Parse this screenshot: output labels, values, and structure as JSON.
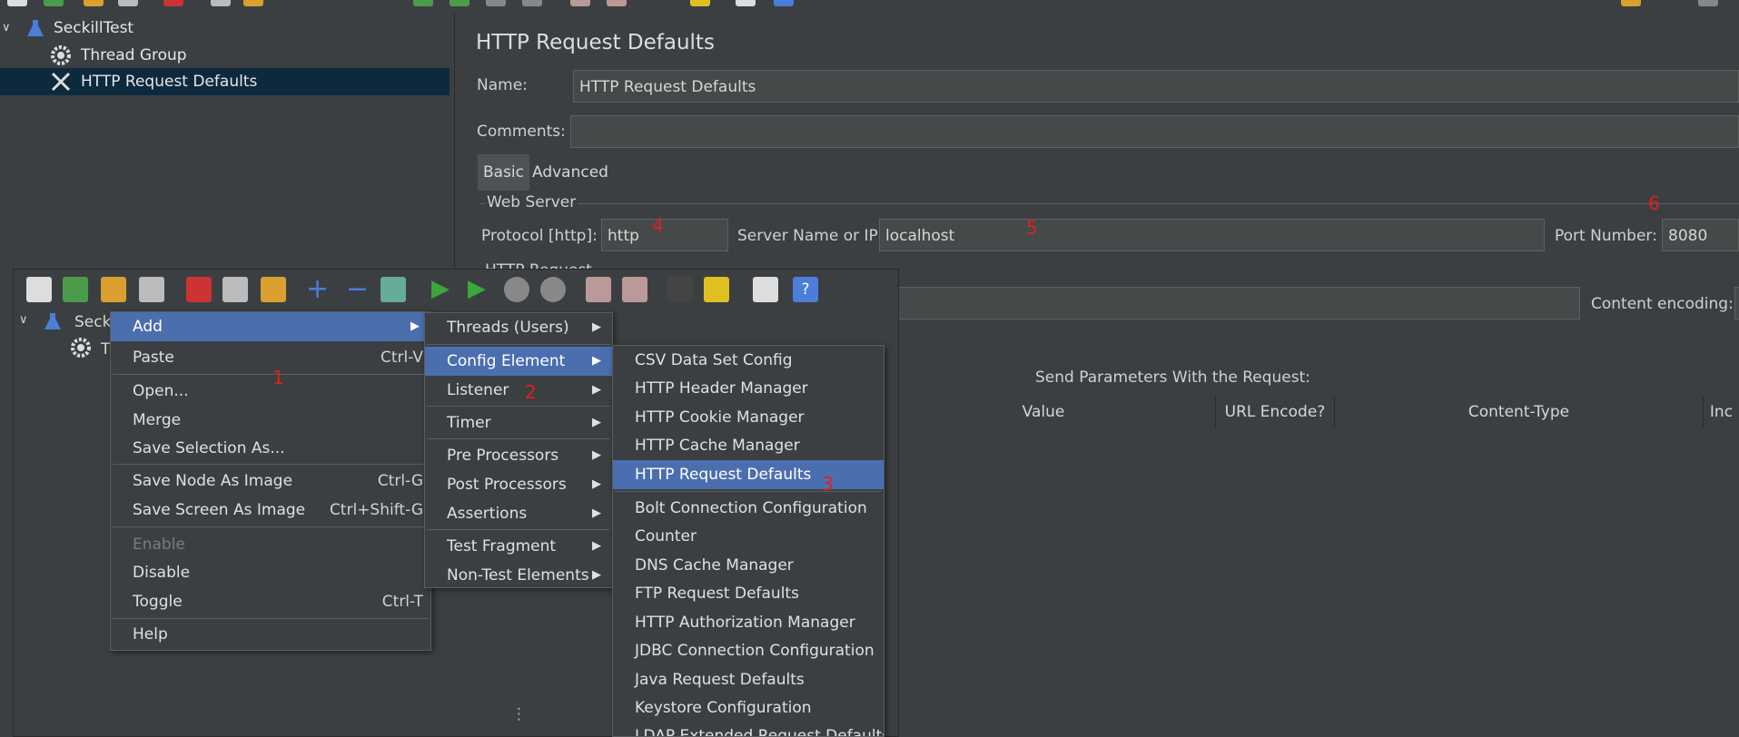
{
  "tree": {
    "root": "SeckillTest",
    "items": [
      "Thread Group",
      "HTTP Request Defaults"
    ]
  },
  "panel": {
    "title": "HTTP Request Defaults",
    "name_label": "Name:",
    "name_value": "HTTP Request Defaults",
    "comments_label": "Comments:",
    "comments_value": "",
    "tabs": [
      "Basic",
      "Advanced"
    ],
    "web_server_label": "Web Server",
    "protocol_label": "Protocol [http]:",
    "protocol_value": "http",
    "server_label": "Server Name or IP:",
    "server_value": "localhost",
    "port_label": "Port Number:",
    "port_value": "8080",
    "http_request_label": "HTTP Request",
    "content_encoding_label": "Content encoding:",
    "send_params_label": "Send Parameters With the Request:",
    "columns": [
      "Value",
      "URL Encode?",
      "Content-Type",
      "Inc"
    ]
  },
  "annotations": {
    "a1": "1",
    "a2": "2",
    "a3": "3",
    "a4": "4",
    "a5": "5",
    "a6": "6"
  },
  "embedded": {
    "tree_root": "Secki",
    "tree_child": "T"
  },
  "context_menu": {
    "items": [
      {
        "label": "Add",
        "shortcut": "",
        "submenu": true
      },
      {
        "label": "Paste",
        "shortcut": "Ctrl-V"
      },
      {
        "label": "Open...",
        "shortcut": ""
      },
      {
        "label": "Merge",
        "shortcut": ""
      },
      {
        "label": "Save Selection As...",
        "shortcut": ""
      },
      {
        "label": "Save Node As Image",
        "shortcut": "Ctrl-G"
      },
      {
        "label": "Save Screen As Image",
        "shortcut": "Ctrl+Shift-G"
      },
      {
        "label": "Enable",
        "shortcut": "",
        "disabled": true
      },
      {
        "label": "Disable",
        "shortcut": ""
      },
      {
        "label": "Toggle",
        "shortcut": "Ctrl-T"
      },
      {
        "label": "Help",
        "shortcut": ""
      }
    ]
  },
  "add_submenu": {
    "items": [
      "Threads (Users)",
      "Config Element",
      "Listener",
      "Timer",
      "Pre Processors",
      "Post Processors",
      "Assertions",
      "Test Fragment",
      "Non-Test Elements"
    ]
  },
  "config_submenu": {
    "items": [
      "CSV Data Set Config",
      "HTTP Header Manager",
      "HTTP Cookie Manager",
      "HTTP Cache Manager",
      "HTTP Request Defaults",
      "Bolt Connection Configuration",
      "Counter",
      "DNS Cache Manager",
      "FTP Request Defaults",
      "HTTP Authorization Manager",
      "JDBC Connection Configuration",
      "Java Request Defaults",
      "Keystore Configuration",
      "LDAP Extended Request Defaults"
    ]
  },
  "colors": {
    "background": "#3c3f41",
    "selection": "#0d293e",
    "menu_highlight": "#4b6eaf",
    "annotation": "#e02020"
  }
}
